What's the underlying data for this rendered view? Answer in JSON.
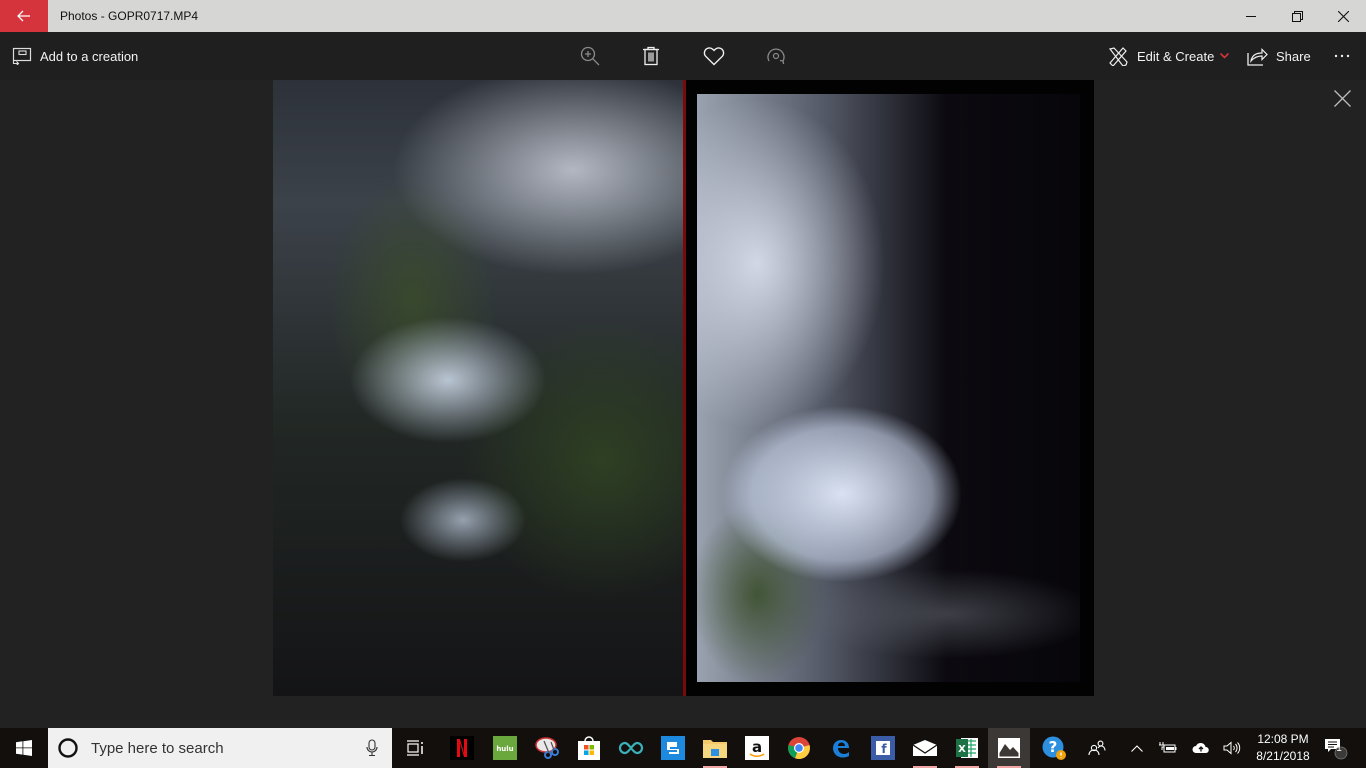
{
  "window": {
    "title": "Photos - GOPR0717.MP4",
    "accent_color": "#d5343c",
    "controls": [
      "minimize",
      "restore",
      "close"
    ]
  },
  "toolbar": {
    "add_to_creation_label": "Add to a creation",
    "center_icons": [
      "zoom-in-icon",
      "delete-icon",
      "favorite-heart-icon",
      "rotate-icon"
    ],
    "edit_create_label": "Edit & Create",
    "share_label": "Share",
    "more_label": "..."
  },
  "viewer": {
    "content": "Video frame: two-panel underwater/tree-canopy footage split by red divider",
    "close_icon": "close-icon"
  },
  "taskbar": {
    "search_placeholder": "Type here to search",
    "apps": [
      {
        "name": "task-view",
        "running": false
      },
      {
        "name": "netflix",
        "running": false
      },
      {
        "name": "hulu",
        "label": "hulu",
        "running": false
      },
      {
        "name": "snip-sketch",
        "running": false
      },
      {
        "name": "microsoft-store",
        "running": false
      },
      {
        "name": "arduino",
        "running": false
      },
      {
        "name": "sway",
        "running": false
      },
      {
        "name": "file-explorer",
        "running": true
      },
      {
        "name": "amazon",
        "label": "a",
        "running": false
      },
      {
        "name": "chrome",
        "running": false
      },
      {
        "name": "edge",
        "running": false
      },
      {
        "name": "facebook",
        "label": "f",
        "running": false
      },
      {
        "name": "mail",
        "running": true
      },
      {
        "name": "excel",
        "label": "X",
        "running": true
      },
      {
        "name": "photos",
        "running": true,
        "active": true
      },
      {
        "name": "get-help",
        "running": false
      }
    ],
    "tray": {
      "time": "12:08 PM",
      "date": "8/21/2018",
      "notification_count": "1"
    }
  }
}
